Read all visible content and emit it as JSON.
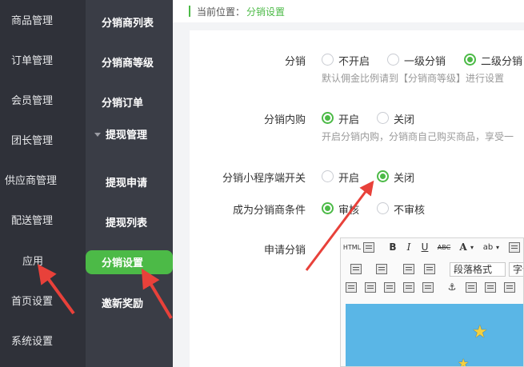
{
  "sidebar_primary": {
    "items": [
      {
        "label": "商品管理"
      },
      {
        "label": "订单管理"
      },
      {
        "label": "会员管理"
      },
      {
        "label": "团长管理"
      },
      {
        "label": "供应商管理"
      },
      {
        "label": "配送管理"
      },
      {
        "label": "应用"
      },
      {
        "label": "首页设置"
      },
      {
        "label": "系统设置"
      }
    ]
  },
  "sidebar_secondary": {
    "items": [
      {
        "label": "分销商列表"
      },
      {
        "label": "分销商等级"
      },
      {
        "label": "分销订单"
      },
      {
        "label": "提现管理"
      },
      {
        "label": "提现申请"
      },
      {
        "label": "提现列表"
      },
      {
        "label": "分销设置"
      },
      {
        "label": "邀新奖励"
      }
    ],
    "active": "分销设置"
  },
  "breadcrumb": {
    "label": "当前位置：",
    "current": "分销设置"
  },
  "form": {
    "distribution": {
      "label": "分销",
      "options": [
        "不开启",
        "一级分销",
        "二级分销"
      ],
      "selected": "二级分销",
      "hint": "默认佣金比例请到【分销商等级】进行设置"
    },
    "self_purchase": {
      "label": "分销内购",
      "options": [
        "开启",
        "关闭"
      ],
      "selected": "开启",
      "hint": "开启分销内购，分销商自己购买商品，享受一"
    },
    "mini_program_switch": {
      "label": "分销小程序端开关",
      "options": [
        "开启",
        "关闭"
      ],
      "selected": "关闭"
    },
    "become_condition": {
      "label": "成为分销商条件",
      "options": [
        "审核",
        "不审核"
      ],
      "selected": "审核"
    },
    "apply": {
      "label": "申请分销"
    }
  },
  "editor": {
    "toolbar_row1": [
      "HTML",
      "B",
      "I",
      "U",
      "ABC",
      "A",
      "ab"
    ],
    "format_select": "段落格式",
    "font_select": "字体"
  },
  "colors": {
    "accent": "#4cba47",
    "sidebar_primary_bg": "#2f3139",
    "sidebar_secondary_bg": "#3a3d46",
    "annotation_arrow": "#e8413a"
  }
}
